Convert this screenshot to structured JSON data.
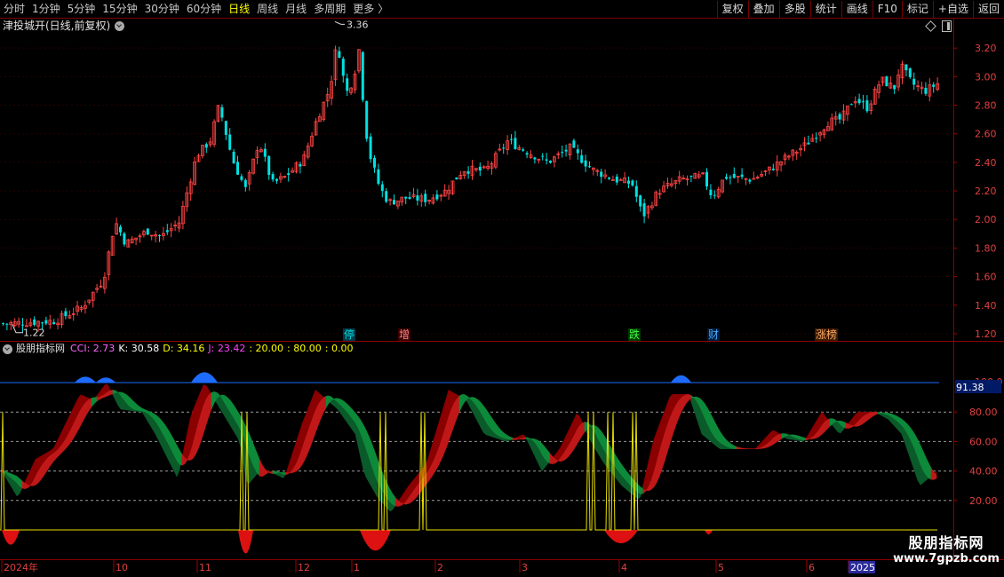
{
  "toolbar": {
    "periods": [
      {
        "label": "分时",
        "active": false
      },
      {
        "label": "1分钟",
        "active": false
      },
      {
        "label": "5分钟",
        "active": false
      },
      {
        "label": "15分钟",
        "active": false
      },
      {
        "label": "30分钟",
        "active": false
      },
      {
        "label": "60分钟",
        "active": false
      },
      {
        "label": "日线",
        "active": true
      },
      {
        "label": "周线",
        "active": false
      },
      {
        "label": "月线",
        "active": false
      },
      {
        "label": "多周期",
        "active": false
      },
      {
        "label": "更多",
        "active": false
      }
    ],
    "more_arrow": "〉",
    "buttons": [
      "复权",
      "叠加",
      "多股",
      "统计",
      "画线",
      "F10",
      "标记",
      "+自选",
      "返回"
    ]
  },
  "stock": {
    "title": "津投城开(日线,前复权)"
  },
  "price_axis": {
    "labels": [
      "3.20",
      "3.00",
      "2.80",
      "2.60",
      "2.40",
      "2.20",
      "2.00",
      "1.80",
      "1.60",
      "1.40",
      "1.20"
    ],
    "min": 1.15,
    "max": 3.4
  },
  "price_annotations": {
    "high": "3.36",
    "low": "1.22",
    "high_value": 3.36,
    "low_value": 1.22
  },
  "event_tags": [
    {
      "label": "停",
      "color": "#00dddd",
      "bg": "#003a4a"
    },
    {
      "label": "增",
      "color": "#ff8888",
      "bg": "#3a0000"
    },
    {
      "label": "跌",
      "color": "#44ff44",
      "bg": "#003a00"
    },
    {
      "label": "财",
      "color": "#44aaff",
      "bg": "#001a3a"
    },
    {
      "label": "涨榜",
      "color": "#ffaa66",
      "bg": "#3a1a00"
    }
  ],
  "indicator": {
    "name": "股朋指标网",
    "values": [
      {
        "text": "CCI: 2.73",
        "color": "#ff66ff"
      },
      {
        "text": "K: 30.58",
        "color": "#ffffff"
      },
      {
        "text": "D: 34.16",
        "color": "#ffff00"
      },
      {
        "text": "J: 23.42",
        "color": "#ff44ff"
      },
      {
        "text": ": 20.00",
        "color": "#ffff00"
      },
      {
        "text": ": 80.00",
        "color": "#ffff00"
      },
      {
        "text": ": 0.00",
        "color": "#ffff00"
      }
    ],
    "axis_labels": [
      "80.00",
      "60.00",
      "40.00",
      "20.00"
    ],
    "current_value": "91.38",
    "top_label": "100.0",
    "min": 0,
    "max": 100
  },
  "date_axis": {
    "labels": [
      "2024年",
      "10",
      "11",
      "12",
      "1",
      "2",
      "3",
      "4",
      "5",
      "6",
      "2025"
    ]
  },
  "watermark": {
    "line1": "股朋指标网",
    "line2": "www.7gpzb.com"
  },
  "colors": {
    "up": "#ff4444",
    "down": "#00e0e0",
    "blue": "#1e6cff",
    "darkred": "#8b0000",
    "red": "#dd1111",
    "green": "#0d8a3a",
    "darkgreen": "#0a5a2a",
    "yellow": "#e8e000"
  }
}
